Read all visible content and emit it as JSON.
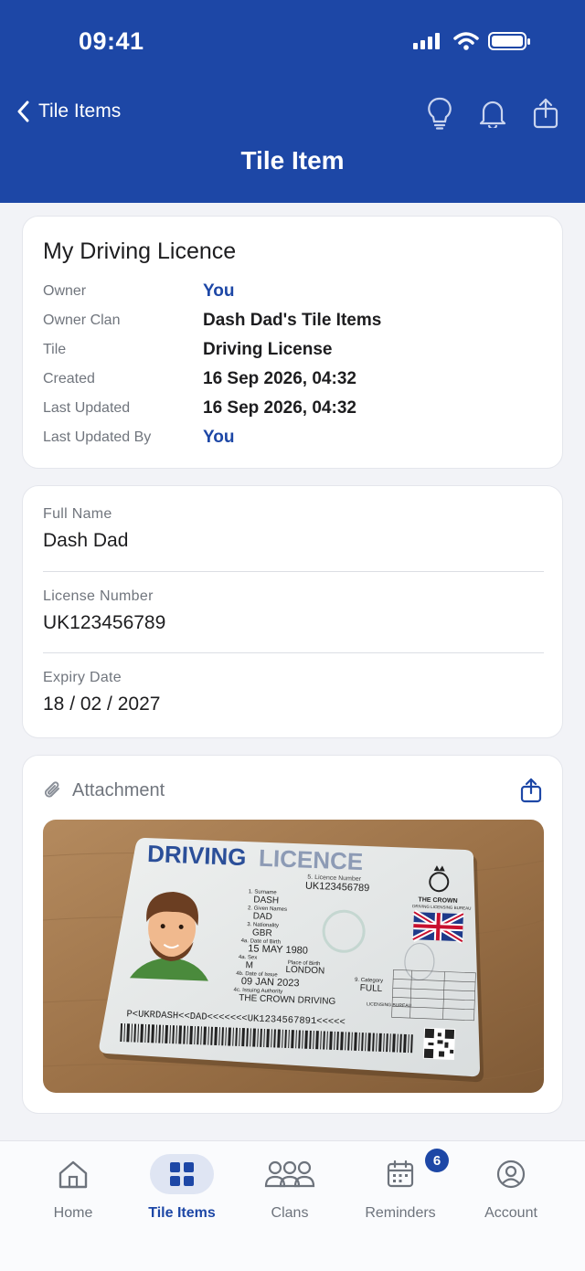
{
  "status_bar": {
    "time": "09:41"
  },
  "nav": {
    "back_label": "Tile Items",
    "title": "Tile Item",
    "actions": [
      "lightbulb-icon",
      "bell-icon",
      "share-icon"
    ]
  },
  "summary": {
    "title": "My Driving Licence",
    "rows": [
      {
        "label": "Owner",
        "value": "You",
        "link": true
      },
      {
        "label": "Owner Clan",
        "value": "Dash Dad's Tile Items",
        "link": false
      },
      {
        "label": "Tile",
        "value": "Driving License",
        "link": false
      },
      {
        "label": "Created",
        "value": "16 Sep 2026, 04:32",
        "link": false
      },
      {
        "label": "Last Updated",
        "value": "16 Sep 2026, 04:32",
        "link": false
      },
      {
        "label": "Last Updated By",
        "value": "You",
        "link": true
      }
    ]
  },
  "fields": [
    {
      "label": "Full Name",
      "value": "Dash Dad"
    },
    {
      "label": "License Number",
      "value": "UK123456789"
    },
    {
      "label": "Expiry Date",
      "value": "18 / 02 / 2027"
    }
  ],
  "attachment": {
    "heading": "Attachment",
    "licence": {
      "title_a": "DRIVING",
      "title_b": "LICENCE",
      "licence_number_label": "5. Licence Number",
      "licence_number": "UK123456789",
      "surname_label": "1. Surname",
      "surname": "DASH",
      "given_label": "2. Given Names",
      "given": "DAD",
      "nationality_label": "3. Nationality",
      "nationality": "GBR",
      "dob_label": "4a. Date of Birth",
      "dob": "15 MAY 1980",
      "sex_label": "4a. Sex",
      "sex": "M",
      "pob_label": "Place of Birth",
      "pob": "LONDON",
      "issue_label": "4b. Date of Issue",
      "issue": "09 JAN 2023",
      "authority_label": "4c. Issuing Authority",
      "authority": "THE CROWN DRIVING",
      "authority_small": "LICENSING BUREAU",
      "category_label": "9. Category",
      "category": "FULL",
      "crown_line1": "THE CROWN",
      "crown_line2": "DRIVING LICENSING BUREAU",
      "mrz": "P<UKRDASH<<DAD<<<<<<<UK1234567891<<<<<"
    }
  },
  "tabbar": {
    "tabs": [
      {
        "label": "Home",
        "icon": "home-icon"
      },
      {
        "label": "Tile Items",
        "icon": "grid-icon",
        "active": true
      },
      {
        "label": "Clans",
        "icon": "people-icon"
      },
      {
        "label": "Reminders",
        "icon": "calendar-icon",
        "badge": "6"
      },
      {
        "label": "Account",
        "icon": "account-icon"
      }
    ]
  },
  "colors": {
    "brand": "#1d47a6",
    "background": "#f2f3f7"
  }
}
